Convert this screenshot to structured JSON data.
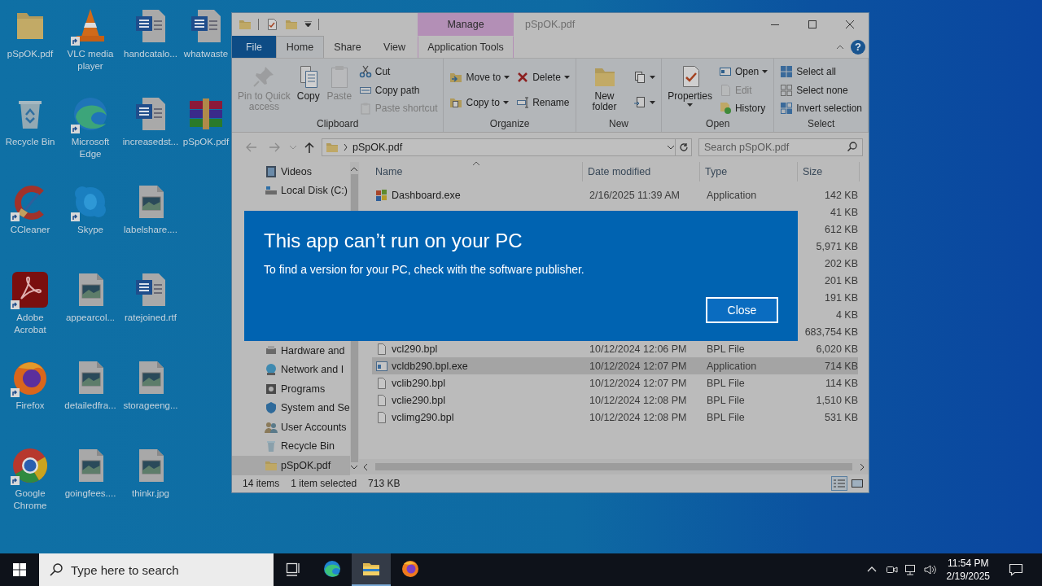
{
  "desktop": {
    "icons": [
      {
        "label": "pSpOK.pdf",
        "kind": "folder",
        "shortcut": false
      },
      {
        "label": "Recycle Bin",
        "kind": "recycle-bin",
        "shortcut": false
      },
      {
        "label": "CCleaner",
        "kind": "cleaner",
        "shortcut": true
      },
      {
        "label": "Adobe Acrobat",
        "kind": "reader",
        "shortcut": true
      },
      {
        "label": "Firefox",
        "kind": "firefox",
        "shortcut": true
      },
      {
        "label": "Google Chrome",
        "kind": "chrome",
        "shortcut": true
      },
      {
        "label": "VLC media player",
        "kind": "cone",
        "shortcut": true
      },
      {
        "label": "Microsoft Edge",
        "kind": "edge",
        "shortcut": true
      },
      {
        "label": "Skype",
        "kind": "bubble",
        "shortcut": true
      },
      {
        "label": "appearcol...",
        "kind": "image",
        "shortcut": false
      },
      {
        "label": "detailedfra...",
        "kind": "image",
        "shortcut": false
      },
      {
        "label": "goingfees....",
        "kind": "image",
        "shortcut": false
      },
      {
        "label": "handcatalo...",
        "kind": "document",
        "shortcut": false
      },
      {
        "label": "increasedst...",
        "kind": "document",
        "shortcut": false
      },
      {
        "label": "labelshare....",
        "kind": "image",
        "shortcut": false
      },
      {
        "label": "ratejoined.rtf",
        "kind": "document",
        "shortcut": false
      },
      {
        "label": "storageeng...",
        "kind": "image",
        "shortcut": false
      },
      {
        "label": "thinkr.jpg",
        "kind": "image",
        "shortcut": false
      },
      {
        "label": "whatwaste",
        "kind": "document",
        "shortcut": false
      },
      {
        "label": "pSpOK.pdf",
        "kind": "archive",
        "shortcut": false
      }
    ]
  },
  "explorer": {
    "title": "pSpOK.pdf",
    "context_tab": "Manage",
    "help_button": "?",
    "tabs": [
      {
        "label": "File",
        "kind": "file",
        "selected": false
      },
      {
        "label": "Home",
        "kind": "tab",
        "selected": true
      },
      {
        "label": "Share",
        "kind": "tab",
        "selected": false
      },
      {
        "label": "View",
        "kind": "tab",
        "selected": false
      },
      {
        "label": "Application Tools",
        "kind": "context",
        "selected": false
      }
    ],
    "ribbon": [
      {
        "label": "Clipboard",
        "columns": [
          {
            "kind": "large",
            "items": [
              {
                "label": "Pin to Quick access",
                "kind": "pin",
                "disabled": true,
                "dropdown": false
              },
              {
                "label": "Copy",
                "kind": "copy",
                "disabled": false,
                "dropdown": false
              },
              {
                "label": "Paste",
                "kind": "paste",
                "disabled": true,
                "dropdown": false
              }
            ]
          },
          {
            "kind": "small",
            "items": [
              {
                "label": "Cut",
                "kind": "cut",
                "disabled": false,
                "dropdown": false
              },
              {
                "label": "Copy path",
                "kind": "copy-path",
                "disabled": false,
                "dropdown": false
              },
              {
                "label": "Paste shortcut",
                "kind": "paste-shortcut",
                "disabled": true,
                "dropdown": false
              }
            ]
          }
        ]
      },
      {
        "label": "Organize",
        "columns": [
          {
            "kind": "small",
            "items": [
              {
                "label": "Move to",
                "kind": "move",
                "disabled": false,
                "dropdown": true
              },
              {
                "label": "Copy to",
                "kind": "copy-to",
                "disabled": false,
                "dropdown": true
              }
            ]
          },
          {
            "kind": "small",
            "items": [
              {
                "label": "Delete",
                "kind": "delete",
                "disabled": false,
                "dropdown": true
              },
              {
                "label": "Rename",
                "kind": "rename",
                "disabled": false,
                "dropdown": false
              }
            ]
          }
        ]
      },
      {
        "label": "New",
        "columns": [
          {
            "kind": "large",
            "items": [
              {
                "label": "New folder",
                "kind": "new-folder",
                "disabled": false,
                "dropdown": false
              }
            ]
          },
          {
            "kind": "small",
            "items": [
              {
                "kind": "new-item",
                "disabled": false,
                "dropdown": true
              },
              {
                "kind": "easy-access",
                "disabled": false,
                "dropdown": true
              }
            ]
          }
        ]
      },
      {
        "label": "Open",
        "columns": [
          {
            "kind": "large",
            "items": [
              {
                "label": "Properties",
                "kind": "properties",
                "disabled": false,
                "dropdown": true
              }
            ]
          },
          {
            "kind": "small",
            "items": [
              {
                "label": "Open",
                "kind": "open",
                "disabled": false,
                "dropdown": true
              },
              {
                "label": "Edit",
                "kind": "edit",
                "disabled": true,
                "dropdown": false
              },
              {
                "label": "History",
                "kind": "history",
                "disabled": false,
                "dropdown": false
              }
            ]
          }
        ]
      },
      {
        "label": "Select",
        "columns": [
          {
            "kind": "small",
            "items": [
              {
                "label": "Select all",
                "kind": "select-all",
                "disabled": false,
                "dropdown": false
              },
              {
                "label": "Select none",
                "kind": "select-none",
                "disabled": false,
                "dropdown": false
              },
              {
                "label": "Invert selection",
                "kind": "invert",
                "disabled": false,
                "dropdown": false
              }
            ]
          }
        ]
      }
    ],
    "address": {
      "path": "pSpOK.pdf",
      "search_placeholder": "Search pSpOK.pdf"
    },
    "nav_pane": {
      "top_items": [
        {
          "label": "Videos",
          "kind": "videos",
          "selected": false
        },
        {
          "label": "Local Disk (C:)",
          "kind": "drive",
          "selected": false
        }
      ],
      "bottom_items": [
        {
          "label": "Hardware and",
          "kind": "hardware",
          "selected": false
        },
        {
          "label": "Network and I",
          "kind": "network",
          "selected": false
        },
        {
          "label": "Programs",
          "kind": "programs",
          "selected": false
        },
        {
          "label": "System and Se",
          "kind": "system",
          "selected": false
        },
        {
          "label": "User Accounts",
          "kind": "users",
          "selected": false
        },
        {
          "label": "Recycle Bin",
          "kind": "recycle-bin",
          "selected": false
        },
        {
          "label": "pSpOK.pdf",
          "kind": "folder",
          "selected": true
        }
      ]
    },
    "file_list": {
      "columns": [
        {
          "label": "Name",
          "sorted": true
        },
        {
          "label": "Date modified",
          "sorted": false
        },
        {
          "label": "Type",
          "sorted": false
        },
        {
          "label": "Size",
          "sorted": false
        }
      ],
      "rows": [
        {
          "name": "Dashboard.exe",
          "date": "2/16/2025 11:39 AM",
          "type": "Application",
          "size": "142 KB",
          "kind": "squares",
          "selected": false
        },
        {
          "size": "41 KB",
          "selected": false
        },
        {
          "size": "612 KB",
          "selected": false
        },
        {
          "size": "5,971 KB",
          "selected": false
        },
        {
          "size": "202 KB",
          "selected": false
        },
        {
          "size": "201 KB",
          "selected": false
        },
        {
          "size": "191 KB",
          "selected": false
        },
        {
          "size": "4 KB",
          "selected": false
        },
        {
          "size": "683,754 KB",
          "selected": false
        },
        {
          "name": "vcl290.bpl",
          "date": "10/12/2024 12:06 PM",
          "type": "BPL File",
          "size": "6,020 KB",
          "kind": "file",
          "selected": false
        },
        {
          "name": "vcldb290.bpl.exe",
          "date": "10/12/2024 12:07 PM",
          "type": "Application",
          "size": "714 KB",
          "kind": "app",
          "selected": true
        },
        {
          "name": "vclib290.bpl",
          "date": "10/12/2024 12:07 PM",
          "type": "BPL File",
          "size": "114 KB",
          "kind": "file",
          "selected": false
        },
        {
          "name": "vclie290.bpl",
          "date": "10/12/2024 12:08 PM",
          "type": "BPL File",
          "size": "1,510 KB",
          "kind": "file",
          "selected": false
        },
        {
          "name": "vclimg290.bpl",
          "date": "10/12/2024 12:08 PM",
          "type": "BPL File",
          "size": "531 KB",
          "kind": "file",
          "selected": false
        }
      ]
    },
    "status": {
      "count": "14 items",
      "selection": "1 item selected",
      "size": "713 KB"
    },
    "view_buttons": [
      {
        "kind": "details",
        "selected": true
      },
      {
        "kind": "large-icons",
        "selected": false
      }
    ]
  },
  "dialog": {
    "title": "This app can’t run on your PC",
    "message": "To find a version for your PC, check with the software publisher.",
    "button": "Close"
  },
  "taskbar": {
    "search_placeholder": "Type here to search",
    "apps": [
      {
        "kind": "task-view",
        "active": false
      },
      {
        "kind": "edge",
        "active": false
      },
      {
        "kind": "explorer",
        "active": true
      },
      {
        "kind": "firefox",
        "active": false
      }
    ],
    "time": "11:54 PM",
    "date": "2/19/2025"
  }
}
